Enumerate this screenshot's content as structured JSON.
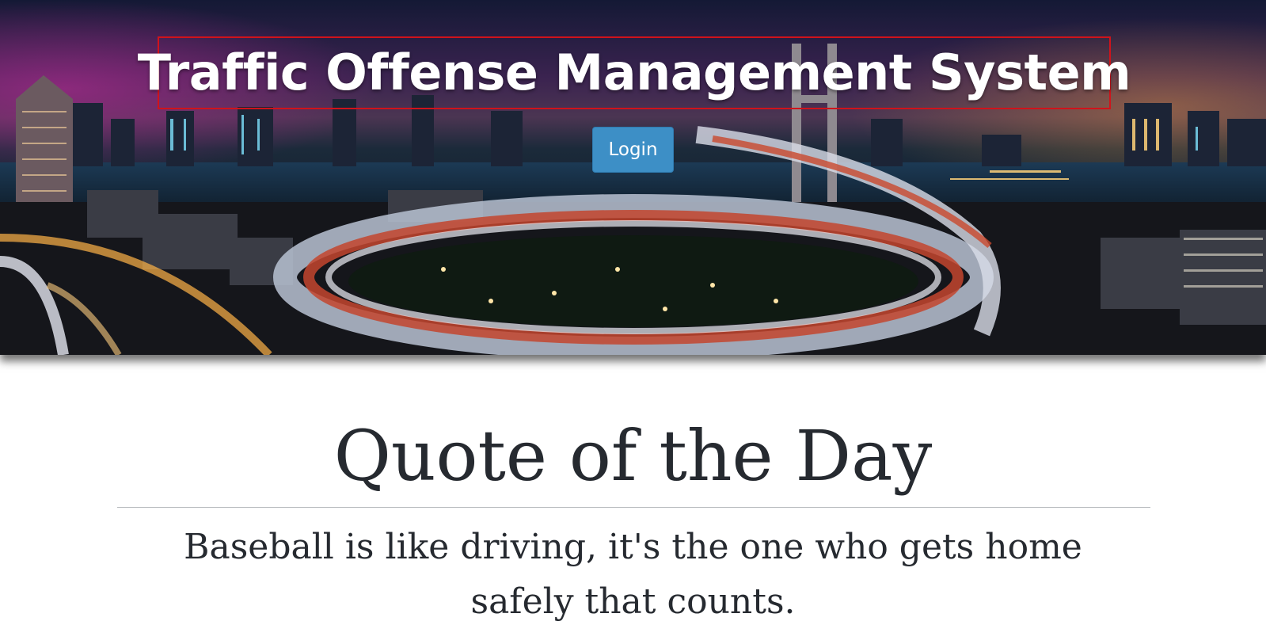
{
  "header": {
    "title": "Traffic Offense Management System",
    "login_label": "Login",
    "hero_image": "night-city-highway-interchange-photo"
  },
  "quote": {
    "heading": "Quote of the Day",
    "text": "Baseball is like driving, it's the one who gets home safely that counts."
  },
  "colors": {
    "login_button": "#3d8fc6",
    "title_border": "#d0131b",
    "heading_text": "#262a30",
    "divider": "#b9bcbf"
  }
}
